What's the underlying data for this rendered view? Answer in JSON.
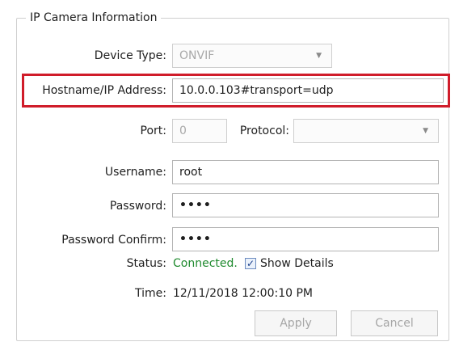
{
  "group": {
    "title": "IP Camera Information"
  },
  "device_type": {
    "label": "Device Type:",
    "value": "ONVIF"
  },
  "hostname": {
    "label": "Hostname/IP Address:",
    "value": "10.0.0.103#transport=udp"
  },
  "port": {
    "label": "Port:",
    "value": "0"
  },
  "protocol": {
    "label": "Protocol:",
    "value": ""
  },
  "username": {
    "label": "Username:",
    "value": "root"
  },
  "password": {
    "label": "Password:",
    "value": "••••"
  },
  "password_confirm": {
    "label": "Password Confirm:",
    "value": "••••"
  },
  "status": {
    "label": "Status:",
    "value": "Connected.",
    "show_details_label": "Show Details",
    "show_details_checked": true,
    "value_color": "#1f8a2e"
  },
  "time": {
    "label": "Time:",
    "value": "12/11/2018 12:00:10 PM"
  },
  "buttons": {
    "apply": "Apply",
    "cancel": "Cancel"
  },
  "colors": {
    "highlight_border": "#d01c2a"
  },
  "icons": {
    "combo_arrow": "chevron-down-icon",
    "checkbox_mark": "checkmark-icon"
  }
}
